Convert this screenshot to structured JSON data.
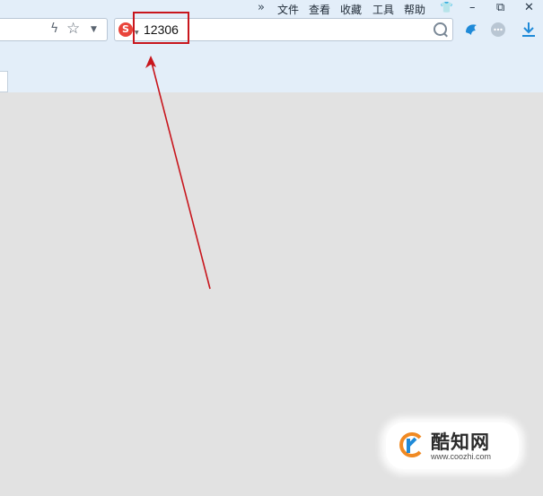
{
  "menubar": {
    "overflow_glyph": "»",
    "items": [
      {
        "label": "文件"
      },
      {
        "label": "查看"
      },
      {
        "label": "收藏"
      },
      {
        "label": "工具"
      },
      {
        "label": "帮助"
      }
    ],
    "window_controls": {
      "skin": "👕",
      "minimize": "–",
      "restore": "⧉",
      "close": "✕"
    }
  },
  "address_bar": {
    "icons": [
      "lightning-icon",
      "star-icon",
      "dropdown-arrow-icon"
    ]
  },
  "search_box": {
    "engine_logo": "S",
    "value": "12306",
    "search_icon": "magnifier-icon"
  },
  "toolbar_icons": [
    "dolphin-icon",
    "chat-bubble-icon",
    "download-icon"
  ],
  "annotation": {
    "color": "#c8161d"
  },
  "watermark": {
    "brand_cn": "酷知网",
    "url": "www.coozhi.com"
  },
  "colors": {
    "chrome_bg": "#e3eef9",
    "page_bg": "#e2e2e2",
    "accent_blue": "#1f8ad8"
  }
}
